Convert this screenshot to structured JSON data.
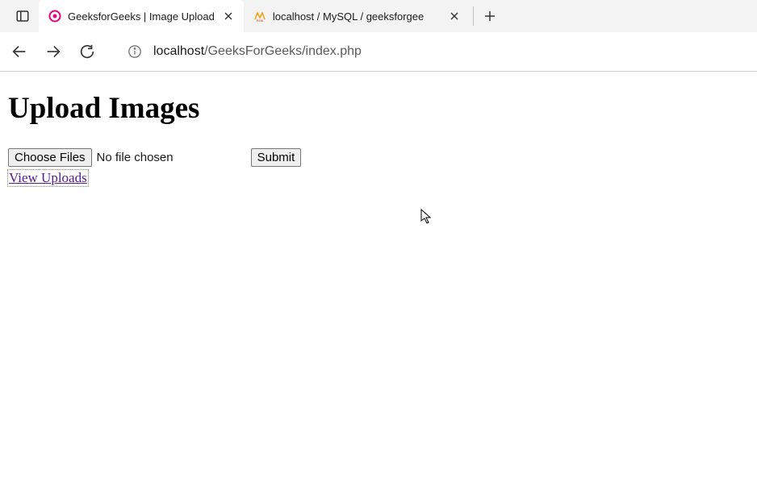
{
  "browser": {
    "tabs": [
      {
        "title": "GeeksforGeeks | Image Upload",
        "favicon": "magenta-circle"
      },
      {
        "title": "localhost / MySQL / geeksforgee",
        "favicon": "pma"
      }
    ],
    "address": {
      "host": "localhost",
      "path": "/GeeksForGeeks/index.php"
    }
  },
  "page": {
    "heading": "Upload Images",
    "choose_files_label": "Choose Files",
    "file_status": "No file chosen",
    "submit_label": "Submit",
    "view_uploads_label": "View Uploads"
  }
}
